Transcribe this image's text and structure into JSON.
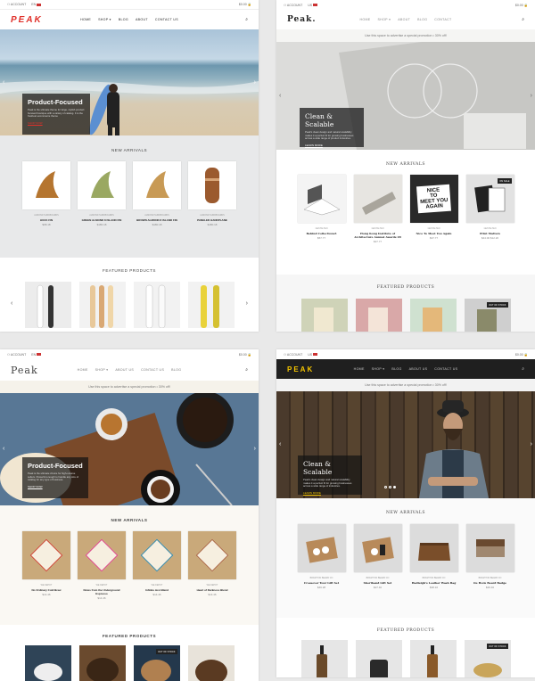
{
  "colors": {
    "accent_red": "#e0302a",
    "accent_yellow": "#f4c400"
  },
  "panel1": {
    "utility": {
      "account": "ACCOUNT",
      "lang": "EN",
      "cart": "$0.00"
    },
    "logo": "PEAK",
    "menu": [
      "HOME",
      "SHOP ▾",
      "BLOG",
      "ABOUT",
      "CONTACT US"
    ],
    "hero": {
      "title": "Product-Focused",
      "text": "Peak is the ultimate theme for large, stylish product focused boutique with a variety of catalog. It is the freshest ecommerce theme",
      "link": "SHOP NOW"
    },
    "new_arrivals_title": "NEW ARRIVALS",
    "products": [
      {
        "vendor": "ALMOND SURFBOARDS",
        "name": "HUCK FIN",
        "price": "$68.18"
      },
      {
        "vendor": "ALMOND SURFBOARDS",
        "name": "GREEN ALMOND 8 ISLAND FIN",
        "price": "$180.18"
      },
      {
        "vendor": "ALMOND SURFBOARDS",
        "name": "BROWN ALMOND 8 ISLAND FIN",
        "price": "$180.18"
      },
      {
        "vendor": "ALMOND SURFBOARDS",
        "name": "PANELED HANDPLANE",
        "price": "$180.18"
      }
    ],
    "featured_title": "FEATURED PRODUCTS"
  },
  "panel2": {
    "utility": {
      "account": "ACCOUNT",
      "lang": "US",
      "cart": "$0.00"
    },
    "logo": "Peak.",
    "menu": [
      "HOME",
      "SHOP ▾",
      "ABOUT",
      "BLOG",
      "CONTACT"
    ],
    "promo": "Use this space to advertise a special promotion • 30% off!",
    "hero": {
      "title": "Clean & Scalable",
      "text": "Peak's clean design and natural scalability makes it a perfect fit for growing businesses across a wide range of product industries.",
      "link": "LEARN MORE"
    },
    "new_arrivals_title": "NEW ARRIVALS",
    "products": [
      {
        "vendor": "GESTALTEN",
        "name": "Behind Collections3",
        "price": "$57.77",
        "badge": ""
      },
      {
        "vendor": "GESTALTEN",
        "name": "Hong Kong Institute of Architecture Annual Awards 09",
        "price": "$37.77",
        "badge": ""
      },
      {
        "vendor": "GESTALTEN",
        "name": "Nice To Meet You Again",
        "price": "$37.77",
        "badge": ""
      },
      {
        "vendor": "GESTALTEN",
        "name": "Print Matters",
        "price": "$44.00 $12.20",
        "badge": "ON SALE"
      }
    ],
    "featured_title": "FEATURED PRODUCTS",
    "featured_badge": "OUT OF STOCK"
  },
  "panel3": {
    "utility": {
      "account": "ACCOUNT",
      "lang": "EN",
      "cart": "$0.00"
    },
    "logo": "Peak",
    "menu": [
      "HOME",
      "SHOP ▾",
      "ABOUT US",
      "CONTACT US",
      "BLOG"
    ],
    "promo": "Use this space to advertise a special promotion • 30% off!",
    "hero": {
      "title": "Product-Focused",
      "text": "Peak is the ultimate choice for high-volume sellers. Powerful enough to handle any size of catalog for any type of business.",
      "link": "SHOP NOW"
    },
    "new_arrivals_title": "NEW ARRIVALS",
    "products": [
      {
        "vendor": "WE DEPOT",
        "name": "No Ordinary Cold Brew",
        "price": "$14.46"
      },
      {
        "vendor": "WE DEPOT",
        "name": "Notes from the Underground Espresso",
        "price": "$14.46"
      },
      {
        "vendor": "WE DEPOT",
        "name": "Infinite Jest Blend",
        "price": "$14.46"
      },
      {
        "vendor": "WE DEPOT",
        "name": "Heart of Darkness Blend",
        "price": "$14.46"
      }
    ],
    "featured_title": "FEATURED PRODUCTS",
    "featured_badge": "OUT OF STOCK"
  },
  "panel4": {
    "utility": {
      "account": "ACCOUNT",
      "lang": "US",
      "cart": "$0.00"
    },
    "logo": "PEAK",
    "menu": [
      "HOME",
      "SHOP ▾",
      "BLOG",
      "ABOUT US",
      "CONTACT US"
    ],
    "promo": "Use this space to advertise a special promotion • 30% off!",
    "hero": {
      "title": "Clean & Scalable",
      "text": "Peak's clean design and natural scalability makes it a perfect fit for growing businesses across a wide range of industries.",
      "link": "LEARN MORE"
    },
    "new_arrivals_title": "NEW ARRIVALS",
    "products": [
      {
        "vendor": "BRIGHTON BEARD CO",
        "name": "Crossover Tour Gift Set",
        "price": "$46.28"
      },
      {
        "vendor": "BRIGHTON BEARD CO",
        "name": "Shorthand Gift Set",
        "price": "$27.40"
      },
      {
        "vendor": "BRIGHTON BEARD CO",
        "name": "Hadleigh's Leather Wash Bag",
        "price": "$38.16"
      },
      {
        "vendor": "BRIGHTON BEARD CO",
        "name": "Oe Horn Beard Badge",
        "price": "$26.46"
      }
    ],
    "featured_title": "FEATURED PRODUCTS",
    "featured_badge": "OUT OF STOCK"
  }
}
